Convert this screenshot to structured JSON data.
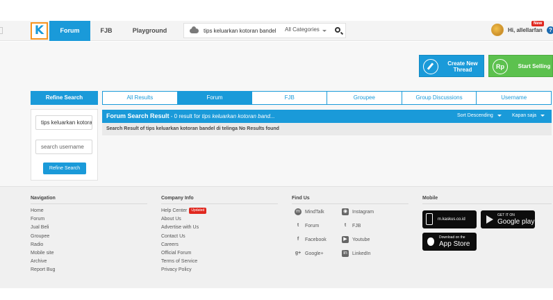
{
  "header": {
    "logo_letter": "K",
    "nav": [
      {
        "label": "Forum",
        "active": true
      },
      {
        "label": "FJB",
        "active": false
      },
      {
        "label": "Playground",
        "active": false
      }
    ],
    "search": {
      "value": "tips keluarkan kotoran bandel",
      "category": "All Categories"
    },
    "user": {
      "greeting": "Hi, allellarfan",
      "badge": "New",
      "help": "?"
    }
  },
  "actions": {
    "create_thread": "Create New Thread",
    "start_selling": "Start Selling",
    "sell_icon_text": "Rp"
  },
  "refine": {
    "title": "Refine Search",
    "keyword_value": "tips keluarkan kotoran bandel",
    "username_placeholder": "search username",
    "button": "Refine Search"
  },
  "tabs": [
    {
      "label": "All Results",
      "active": false
    },
    {
      "label": "Forum",
      "active": true
    },
    {
      "label": "FJB",
      "active": false
    },
    {
      "label": "Groupee",
      "active": false
    },
    {
      "label": "Group Discussions",
      "active": false
    },
    {
      "label": "Username",
      "active": false
    }
  ],
  "results": {
    "title": "Forum Search Result",
    "count_text": " - 0 result for ",
    "query": "tips keluarkan kotoran band...",
    "sort": "Sort Descending",
    "time": "Kapan saja",
    "no_result": "Search Result of tips keluarkan kotoran bandel di telinga No Results found"
  },
  "footer": {
    "navigation": {
      "title": "Navigation",
      "items": [
        "Home",
        "Forum",
        "Jual Beli",
        "Groupee",
        "Radio",
        "Mobile site",
        "Archive",
        "Report Bug"
      ]
    },
    "company": {
      "title": "Company Info",
      "updated_badge": "Updated",
      "items": [
        "Help Center",
        "About Us",
        "Advertise with Us",
        "Contact Us",
        "Careers",
        "Official Forum",
        "Terms of Service",
        "Privacy Policy"
      ]
    },
    "find_us": {
      "title": "Find Us",
      "left": [
        "MindTalk",
        "Forum",
        "Facebook",
        "Google+"
      ],
      "right": [
        "Instagram",
        "FJB",
        "Youtube",
        "LinkedIn"
      ]
    },
    "mobile": {
      "title": "Mobile",
      "site": "m.kaskus.co.id",
      "google_small": "GET IT ON",
      "google_big": "Google play",
      "apple_small": "Download on the",
      "apple_big": "App Store"
    }
  },
  "colors": {
    "accent": "#1a9ad9",
    "sell": "#5cc14e",
    "badge": "#e0281f"
  }
}
